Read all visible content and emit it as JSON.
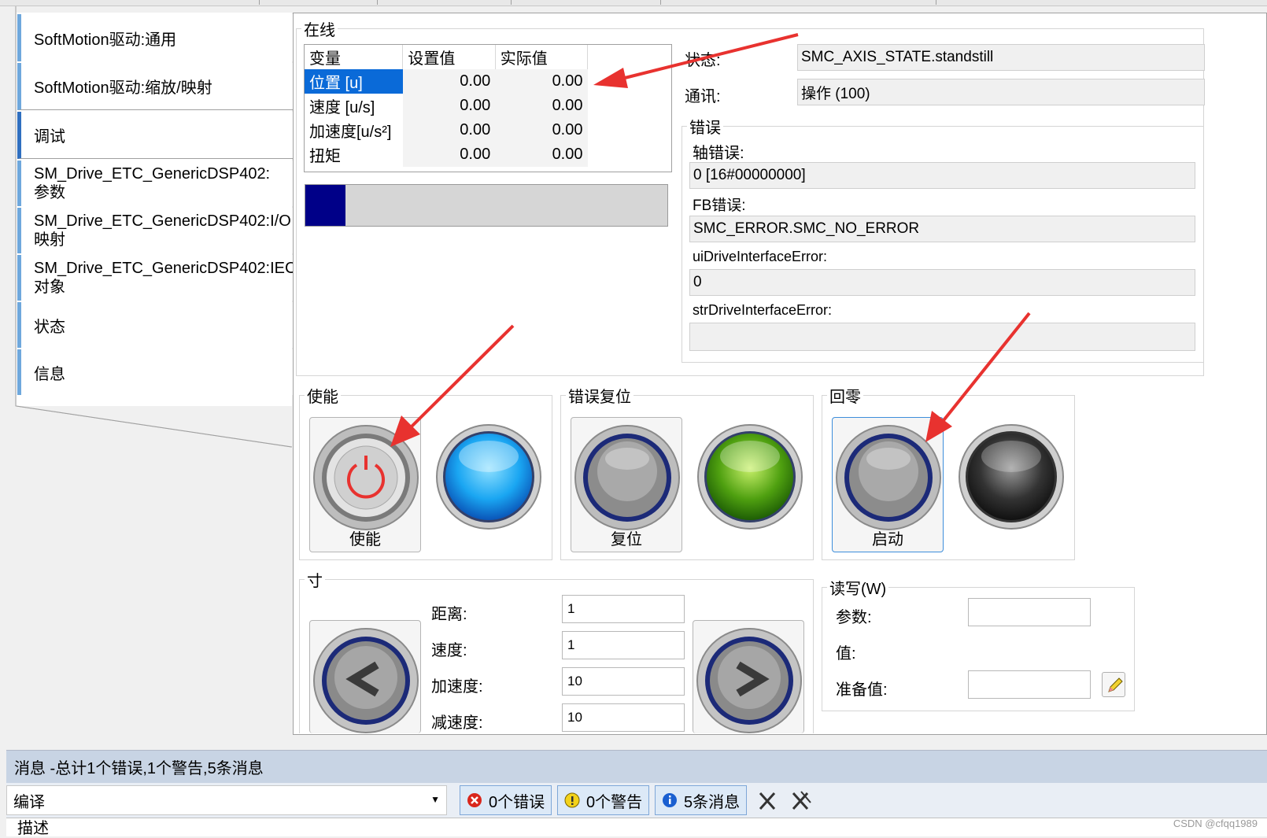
{
  "left_tabs": [
    {
      "label": "SoftMotion驱动:通用"
    },
    {
      "label": "SoftMotion驱动:缩放/映射"
    },
    {
      "label": "调试"
    },
    {
      "label": "SM_Drive_ETC_GenericDSP402:参数"
    },
    {
      "label": "SM_Drive_ETC_GenericDSP402:I/O映射"
    },
    {
      "label": "SM_Drive_ETC_GenericDSP402:IEC对象"
    },
    {
      "label": "状态"
    },
    {
      "label": "信息"
    }
  ],
  "online": {
    "legend": "在线",
    "headers": [
      "变量",
      "设置值",
      "实际值"
    ],
    "rows": [
      {
        "name": "位置 [u]",
        "set": "0.00",
        "actual": "0.00"
      },
      {
        "name": "速度 [u/s]",
        "set": "0.00",
        "actual": "0.00"
      },
      {
        "name": "加速度[u/s²]",
        "set": "0.00",
        "actual": "0.00"
      },
      {
        "name": "扭矩",
        "set": "0.00",
        "actual": "0.00"
      }
    ],
    "progress_fraction": 0.11
  },
  "status": {
    "state_label": "状态:",
    "state_value": "SMC_AXIS_STATE.standstill",
    "comm_label": "通讯:",
    "comm_value": "操作 (100)"
  },
  "errors": {
    "legend": "错误",
    "axis_error_label": "轴错误:",
    "axis_error_value": "0 [16#00000000]",
    "fb_error_label": "FB错误:",
    "fb_error_value": "SMC_ERROR.SMC_NO_ERROR",
    "ui_error_label": "uiDriveInterfaceError:",
    "ui_error_value": "0",
    "str_error_label": "strDriveInterfaceError:",
    "str_error_value": ""
  },
  "enable_group": {
    "legend": "使能",
    "button_label": "使能"
  },
  "reset_group": {
    "legend": "错误复位",
    "button_label": "复位"
  },
  "home_group": {
    "legend": "回零",
    "button_label": "启动"
  },
  "jog": {
    "legend": "寸",
    "distance_label": "距离:",
    "distance_value": "1",
    "speed_label": "速度:",
    "speed_value": "1",
    "accel_label": "加速度:",
    "accel_value": "10",
    "decel_label": "减速度:",
    "decel_value": "10"
  },
  "readwrite": {
    "legend": "读写(W)",
    "param_label": "参数:",
    "value_label": "值:",
    "prepare_label": "准备值:"
  },
  "messages": {
    "header": "消息 -总计1个错误,1个警告,5条消息",
    "source": "编译",
    "errors_btn": "0个错误",
    "warnings_btn": "0个警告",
    "info_btn": "5条消息",
    "desc_col": "描述"
  },
  "watermark": "CSDN @cfqq1989",
  "colors": {
    "accent_red": "#e8322f",
    "progress_fill": "#000088",
    "led_blue": "#1aa6f2",
    "led_green": "#4fa010",
    "led_gray": "#333333"
  }
}
